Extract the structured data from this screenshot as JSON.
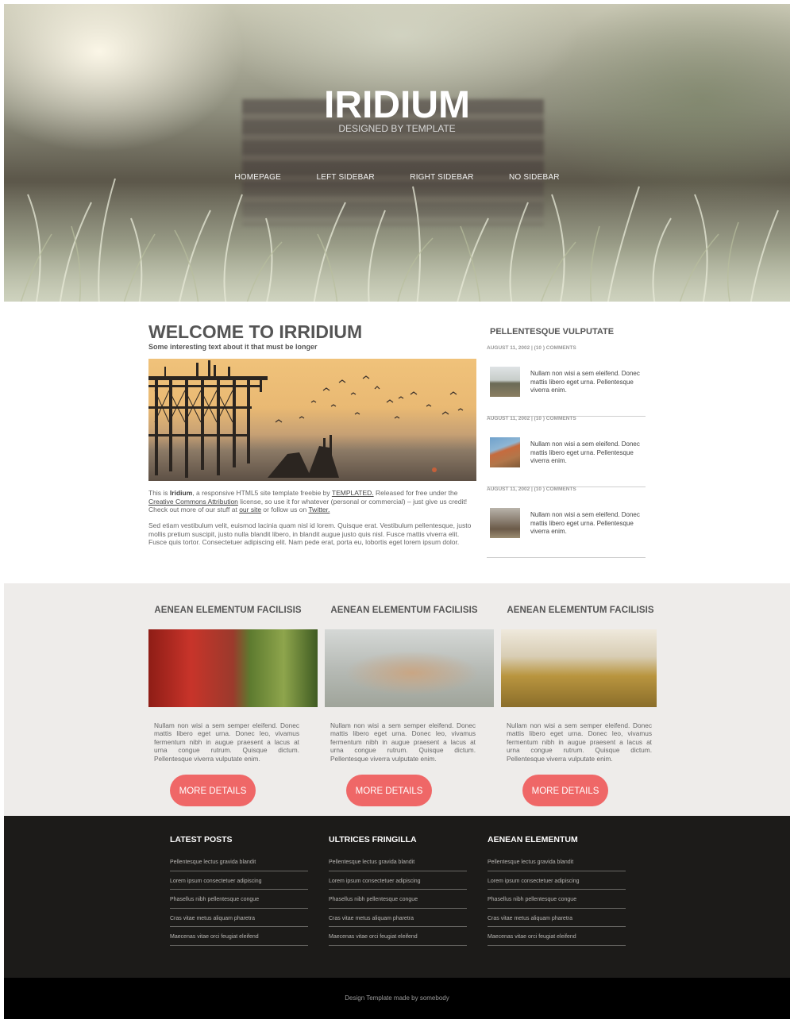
{
  "header": {
    "title": "IRIDIUM",
    "subtitle": "DESIGNED BY TEMPLATE",
    "nav": [
      "HOMEPAGE",
      "LEFT SIDEBAR",
      "RIGHT SIDEBAR",
      "NO SIDEBAR"
    ]
  },
  "main": {
    "title": "WELCOME TO IRRIDIUM",
    "subtitle": "Some interesting text about it that must be longer",
    "intro": {
      "t1": "This is ",
      "brand": "Iridium",
      "t2": ", a responsive HTML5 site template freebie by ",
      "link_templated": "TEMPLATED.",
      "t3": " Released for free under the ",
      "link_license": "Creative Commons Attribution",
      "t4": " license, so use it for whatever (personal or commercial) – just give us credit! Check out more of our stuff at ",
      "link_site": "our site",
      "t5": " or follow us on ",
      "link_twitter": "Twitter."
    },
    "paragraph2": "Sed etiam vestibulum velit, euismod lacinia quam nisl id lorem. Quisque erat. Vestibulum pellentesque, justo mollis pretium suscipit, justo nulla blandit libero, in blandit augue justo quis nisl. Fusce mattis viverra elit. Fusce quis tortor. Consectetuer adipiscing elit. Nam pede erat, porta eu, lobortis eget lorem ipsum dolor."
  },
  "sidebar": {
    "title": "PELLENTESQUE VULPUTATE",
    "posts": [
      {
        "meta": "AUGUST 11, 2002 | (10 ) COMMENTS",
        "text": "Nullam non wisi a sem eleifend. Donec mattis libero eget urna. Pellentesque viverra enim."
      },
      {
        "meta": "AUGUST 11, 2002 | (10 ) COMMENTS",
        "text": "Nullam non wisi a sem eleifend. Donec mattis libero eget urna. Pellentesque viverra enim."
      },
      {
        "meta": "AUGUST 11, 2002 | (10 ) COMMENTS",
        "text": "Nullam non wisi a sem eleifend. Donec mattis libero eget urna. Pellentesque viverra enim."
      }
    ]
  },
  "featured": [
    {
      "title": "AENEAN ELEMENTUM FACILISIS",
      "text": "Nullam non wisi a sem semper eleifend. Donec mattis libero eget urna. Donec leo, vivamus fermentum nibh in augue praesent a lacus at urna congue rutrum. Quisque dictum. Pellentesque viverra vulputate enim.",
      "button": "MORE DETAILS"
    },
    {
      "title": "AENEAN ELEMENTUM FACILISIS",
      "text": "Nullam non wisi a sem semper eleifend. Donec mattis libero eget urna. Donec leo, vivamus fermentum nibh in augue praesent a lacus at urna congue rutrum. Quisque dictum. Pellentesque viverra vulputate enim.",
      "button": "MORE DETAILS"
    },
    {
      "title": "AENEAN ELEMENTUM FACILISIS",
      "text": "Nullam non wisi a sem semper eleifend. Donec mattis libero eget urna. Donec leo, vivamus fermentum nibh in augue praesent a lacus at urna congue rutrum. Quisque dictum. Pellentesque viverra vulputate enim.",
      "button": "MORE DETAILS"
    }
  ],
  "footer": {
    "columns": [
      {
        "title": "LATEST POSTS",
        "links": [
          "Pellentesque lectus gravida blandit",
          "Lorem ipsum consectetuer adipiscing",
          "Phasellus nibh pellentesque congue",
          "Cras vitae metus aliquam pharetra",
          "Maecenas vitae orci feugiat eleifend"
        ]
      },
      {
        "title": "ULTRICES FRINGILLA",
        "links": [
          "Pellentesque lectus gravida blandit",
          "Lorem ipsum consectetuer adipiscing",
          "Phasellus nibh pellentesque congue",
          "Cras vitae metus aliquam pharetra",
          "Maecenas vitae orci feugiat eleifend"
        ]
      },
      {
        "title": "AENEAN ELEMENTUM",
        "links": [
          "Pellentesque lectus gravida blandit",
          "Lorem ipsum consectetuer adipiscing",
          "Phasellus nibh pellentesque congue",
          "Cras vitae metus aliquam pharetra",
          "Maecenas vitae orci feugiat eleifend"
        ]
      }
    ],
    "copyright": "Design Template made by somebody"
  },
  "colors": {
    "accent_button": "#ef6767",
    "featured_background": "#eeecea",
    "footer_background": "#1c1b19",
    "copyright_background": "#000000"
  }
}
